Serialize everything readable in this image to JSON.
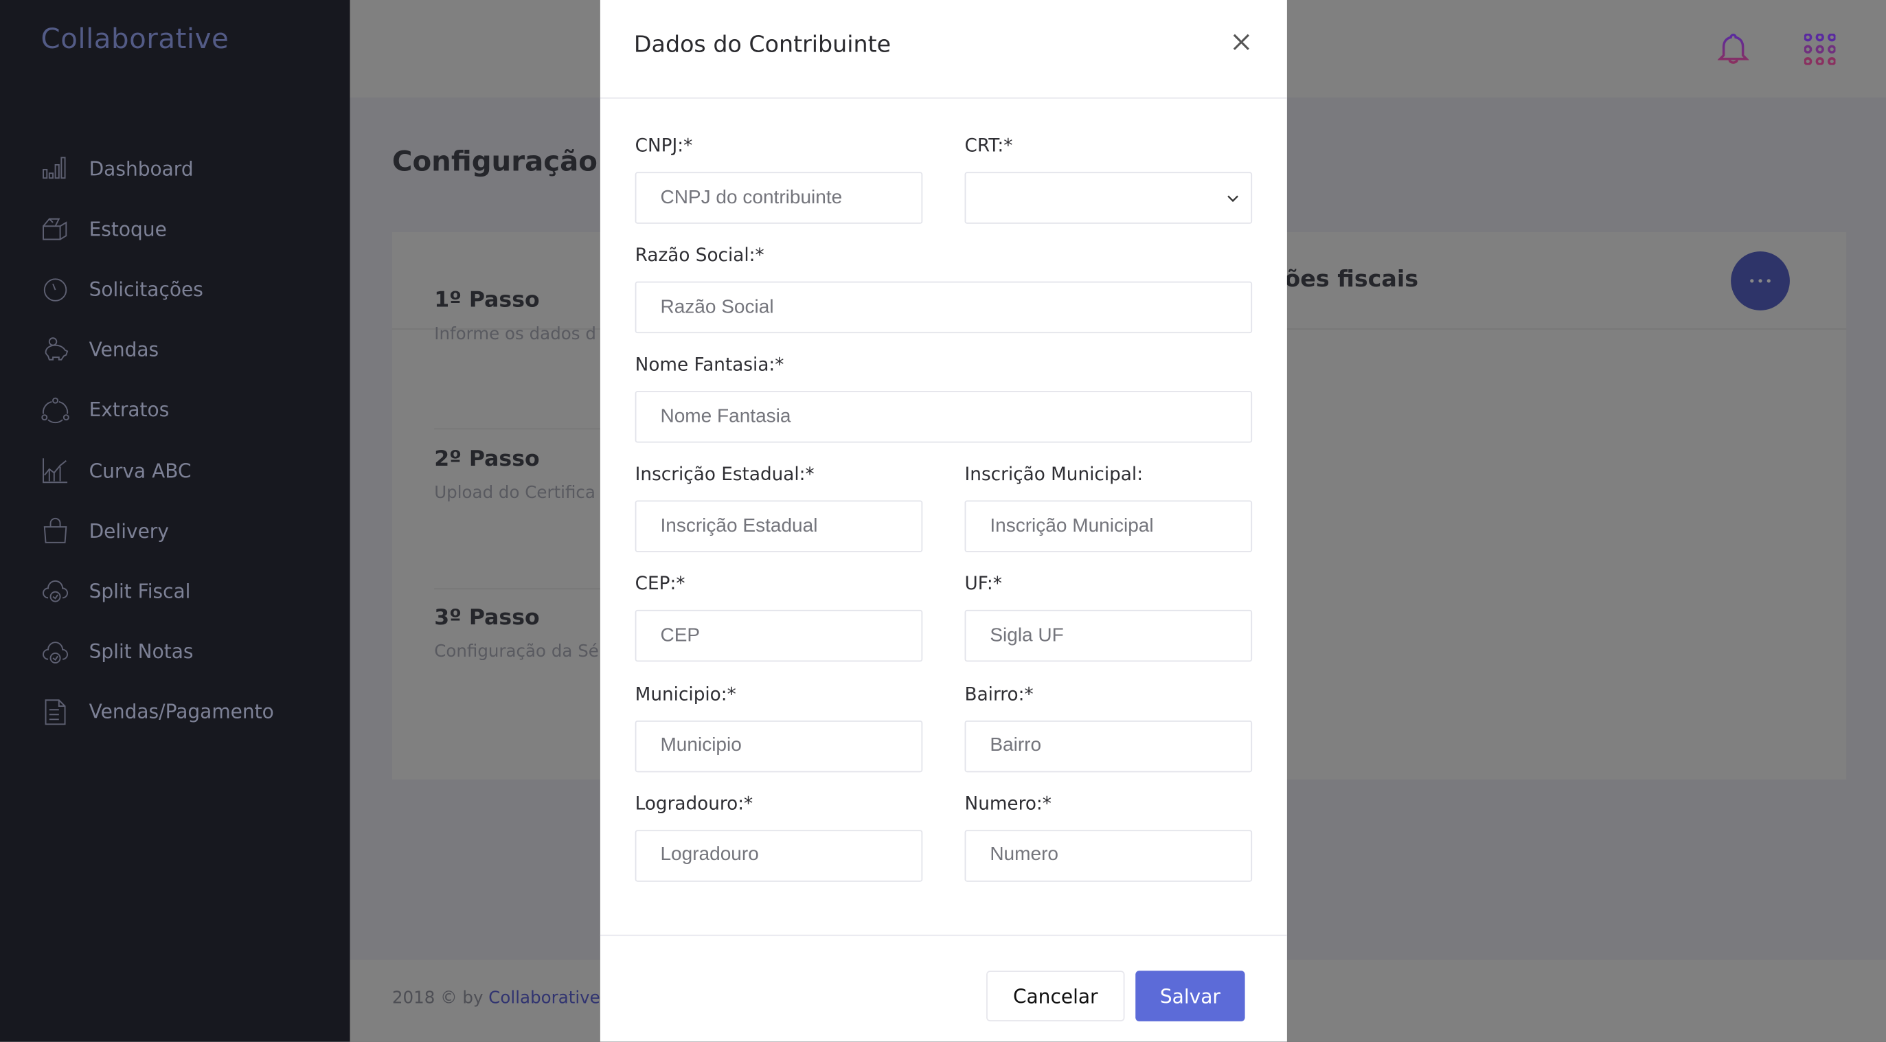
{
  "sidebar": {
    "brand": "Collaborative",
    "items": [
      {
        "label": "Dashboard",
        "icon": "bar-chart-icon"
      },
      {
        "label": "Estoque",
        "icon": "box-icon"
      },
      {
        "label": "Solicitações",
        "icon": "timer-icon"
      },
      {
        "label": "Vendas",
        "icon": "piggy-bank-icon"
      },
      {
        "label": "Extratos",
        "icon": "cycle-icon"
      },
      {
        "label": "Curva ABC",
        "icon": "line-chart-icon"
      },
      {
        "label": "Delivery",
        "icon": "shopping-bag-icon"
      },
      {
        "label": "Split Fiscal",
        "icon": "cloud-check-icon"
      },
      {
        "label": "Split Notas",
        "icon": "cloud-check-icon"
      },
      {
        "label": "Vendas/Pagamento",
        "icon": "document-list-icon"
      }
    ]
  },
  "header": {
    "icons": [
      "bell-icon",
      "apps-grid-icon"
    ]
  },
  "page": {
    "title": "Configuração Fi",
    "card_title": "ões fiscais",
    "steps": [
      {
        "title": "1º Passo",
        "desc": "Informe os dados d"
      },
      {
        "title": "2º Passo",
        "desc": "Upload do Certifica"
      },
      {
        "title": "3º Passo",
        "desc": "Configuração da Sé"
      }
    ],
    "footer": {
      "prefix": "2018 © by ",
      "link": "Collaborative"
    }
  },
  "modal": {
    "title": "Dados do Contribuinte",
    "fields": {
      "cnpj": {
        "label": "CNPJ:*",
        "placeholder": "CNPJ do contribuinte",
        "value": ""
      },
      "crt": {
        "label": "CRT:*",
        "value": ""
      },
      "razao": {
        "label": "Razão Social:*",
        "placeholder": "Razão Social",
        "value": ""
      },
      "fantasia": {
        "label": "Nome Fantasia:*",
        "placeholder": "Nome Fantasia",
        "value": ""
      },
      "ie": {
        "label": "Inscrição Estadual:*",
        "placeholder": "Inscrição Estadual",
        "value": ""
      },
      "im": {
        "label": "Inscrição Municipal:",
        "placeholder": "Inscrição Municipal",
        "value": ""
      },
      "cep": {
        "label": "CEP:*",
        "placeholder": "CEP",
        "value": ""
      },
      "uf": {
        "label": "UF:*",
        "placeholder": "Sigla UF",
        "value": ""
      },
      "municipio": {
        "label": "Municipio:*",
        "placeholder": "Municipio",
        "value": ""
      },
      "bairro": {
        "label": "Bairro:*",
        "placeholder": "Bairro",
        "value": ""
      },
      "logradouro": {
        "label": "Logradouro:*",
        "placeholder": "Logradouro",
        "value": ""
      },
      "numero": {
        "label": "Numero:*",
        "placeholder": "Numero",
        "value": ""
      }
    },
    "cancel": "Cancelar",
    "save": "Salvar"
  },
  "colors": {
    "primary": "#5c6bd8",
    "sidebar": "#17181f",
    "fab": "#2e3469"
  }
}
